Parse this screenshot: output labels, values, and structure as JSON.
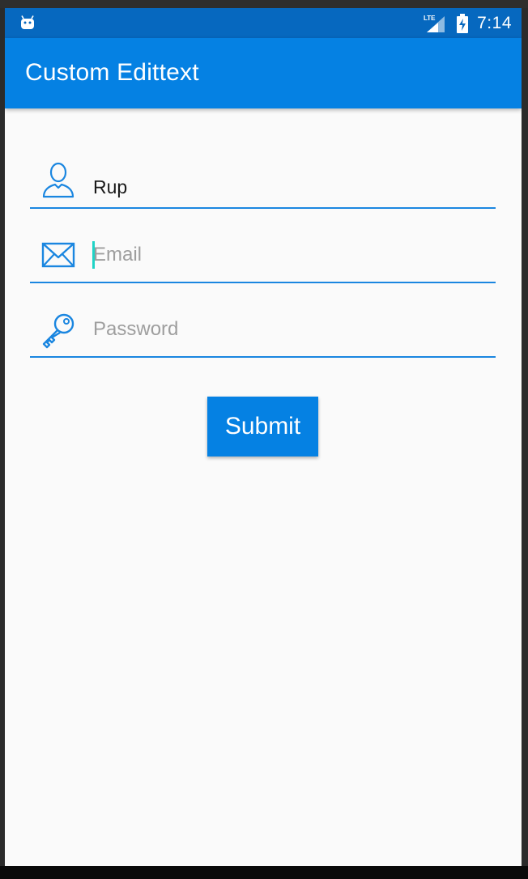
{
  "status_bar": {
    "time": "7:14",
    "network_label": "LTE",
    "left_icon": "android-debug-icon",
    "signal_icon": "signal-icon",
    "battery_icon": "battery-charging-icon"
  },
  "app_bar": {
    "title": "Custom Edittext",
    "color": "#0581e3",
    "status_color": "#0668bf"
  },
  "form": {
    "name": {
      "icon": "user-icon",
      "value": "Rup"
    },
    "email": {
      "icon": "envelope-icon",
      "value": "",
      "placeholder": "Email",
      "focused": true
    },
    "password": {
      "icon": "key-icon",
      "value": "",
      "placeholder": "Password"
    },
    "submit_label": "Submit",
    "underline_color": "#1a86e0",
    "cursor_color": "#1fd3c6"
  }
}
